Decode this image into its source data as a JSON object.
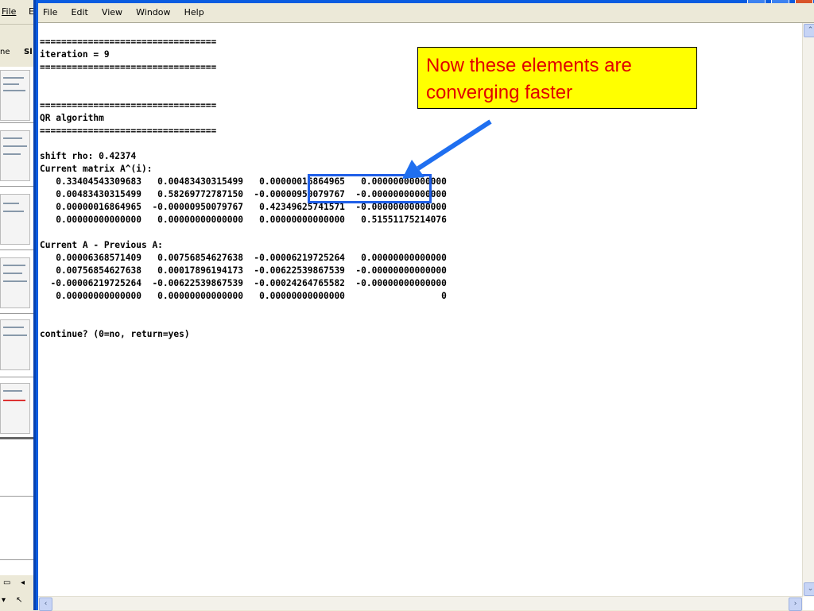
{
  "background_app": {
    "menu": [
      "File",
      "E"
    ],
    "tabs": [
      "ne",
      "Sl"
    ]
  },
  "console_window": {
    "menu": [
      "File",
      "Edit",
      "View",
      "Window",
      "Help"
    ],
    "output_lines": [
      "=================================",
      "iteration = 9",
      "=================================",
      "",
      "",
      "=================================",
      "QR algorithm",
      "=================================",
      "",
      "shift rho: 0.42374",
      "Current matrix A^(i):",
      "   0.33404543309683   0.00483430315499   0.00000016864965   0.00000000000000",
      "   0.00483430315499   0.58269772787150  -0.00000950079767  -0.00000000000000",
      "   0.00000016864965  -0.00000950079767   0.42349625741571  -0.00000000000000",
      "   0.00000000000000   0.00000000000000   0.00000000000000   0.51551175214076",
      "",
      "Current A - Previous A:",
      "   0.00006368571409   0.00756854627638  -0.00006219725264   0.00000000000000",
      "   0.00756854627638   0.00017896194173  -0.00622539867539  -0.00000000000000",
      "  -0.00006219725264  -0.00622539867539  -0.00024264765582  -0.00000000000000",
      "   0.00000000000000   0.00000000000000   0.00000000000000                  0",
      "",
      "",
      "continue? (0=no, return=yes)"
    ]
  },
  "annotation": {
    "text": "Now these elements are converging faster",
    "box_color": "#ffff00",
    "text_color": "#e00000",
    "highlight_color": "#1f5fe8",
    "arrow_color": "#1f6ff0"
  }
}
